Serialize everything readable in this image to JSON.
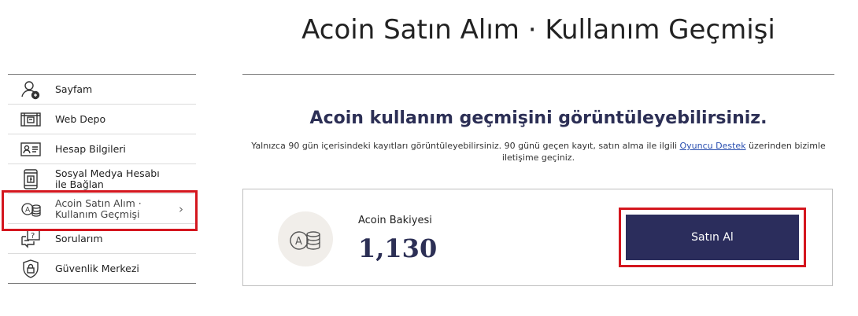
{
  "page": {
    "title": "Acoin Satın Alım · Kullanım Geçmişi",
    "subtitle": "Acoin kullanım geçmişini görüntüleyebilirsiniz.",
    "note_before": "Yalnızca 90 gün içerisindeki kayıtları görüntüleyebilirsiniz. 90 günü geçen kayıt, satın alma ile ilgili ",
    "note_link": "Oyuncu Destek",
    "note_after": " üzerinden bizimle iletişime geçiniz."
  },
  "sidebar": {
    "items": [
      {
        "label": "Sayfam",
        "icon": "user-add-icon"
      },
      {
        "label": "Web Depo",
        "icon": "storage-icon"
      },
      {
        "label": "Hesap Bilgileri",
        "icon": "id-card-icon"
      },
      {
        "label": "Sosyal Medya Hesabı ile Bağlan",
        "icon": "phone-facebook-icon"
      },
      {
        "label": "Acoin Satın Alım · Kullanım Geçmişi",
        "icon": "acoin-coins-icon",
        "active": true
      },
      {
        "label": "Sorularım",
        "icon": "question-chat-icon"
      },
      {
        "label": "Güvenlik Merkezi",
        "icon": "shield-lock-icon"
      }
    ]
  },
  "balance": {
    "label": "Acoin Bakiyesi",
    "value": "1,130",
    "button_label": "Satın Al"
  },
  "colors": {
    "accent": "#2b2d5c",
    "highlight": "#d4161e",
    "link": "#2a4fb0"
  }
}
